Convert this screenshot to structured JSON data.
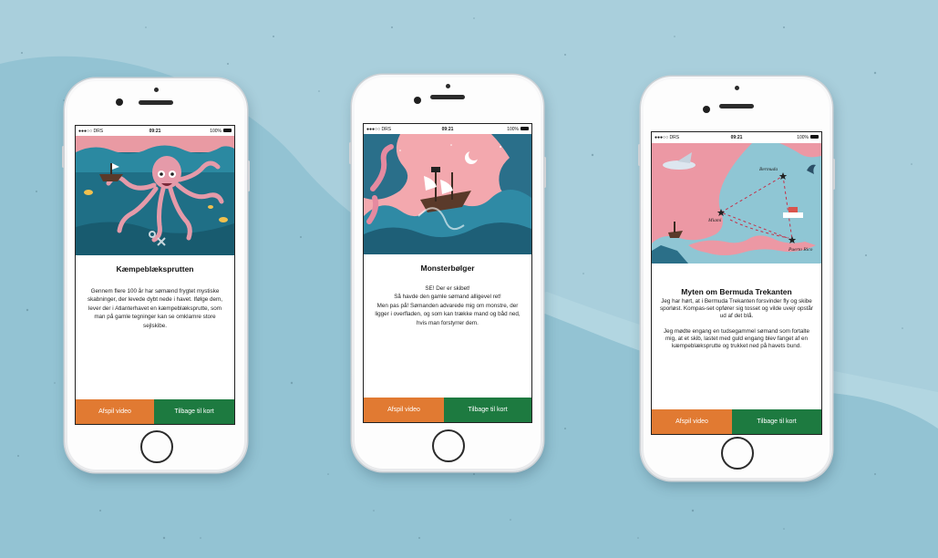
{
  "colors": {
    "background": "#9cc8d6",
    "background_light": "#aed3df",
    "video_button": "#e17a32",
    "back_button": "#1d7a40"
  },
  "status_bar": {
    "carrier": "●●●○○ DRS",
    "time": "09:21",
    "battery": "100%"
  },
  "phones": [
    {
      "illustration": "octopus-illustration",
      "title": "Kæmpeblæksprutten",
      "body": "Gennem flere 100 år har sømænd frygtet mystiske skabninger, der levede dybt nede i havet. Ifølge dem, lever der i Atlanterhavet en kæmpeblæksprutte, som man på gamle tegninger kan se omklamre store sejlskibe.",
      "video_label": "Afspil video",
      "back_label": "Tilbage til kort"
    },
    {
      "illustration": "monster-wave-illustration",
      "title": "Monsterbølger",
      "body_lines": [
        "SE! Der er skibet!",
        "Så havde den gamle sømand alligevel ret!",
        "Men pas på! Sømanden advarede mig om monstre, der ligger i overfladen, og som kan trække mand og båd ned, hvis man forstyrrer dem."
      ],
      "video_label": "Afspil video",
      "back_label": "Tilbage til kort"
    },
    {
      "illustration": "bermuda-map-illustration",
      "map_labels": [
        "Bermuda",
        "Miami",
        "Puerto Rico"
      ],
      "title": "Myten om Bermuda Trekanten",
      "body_lines": [
        "Jeg har hørt, at i Bermuda Trekanten forsvinder fly og skibe sporløst. Kompas-set opfører sig tosset og vilde uvejr opstår ud af det blå.",
        "Jeg mødte engang en tudsegammel sømand som fortalte mig, at et skib, lastet med guld engang blev fanget af en kæmpeblæksprutte og trukket ned på havets bund."
      ],
      "video_label": "Afspil video",
      "back_label": "Tilbage til kort"
    }
  ]
}
